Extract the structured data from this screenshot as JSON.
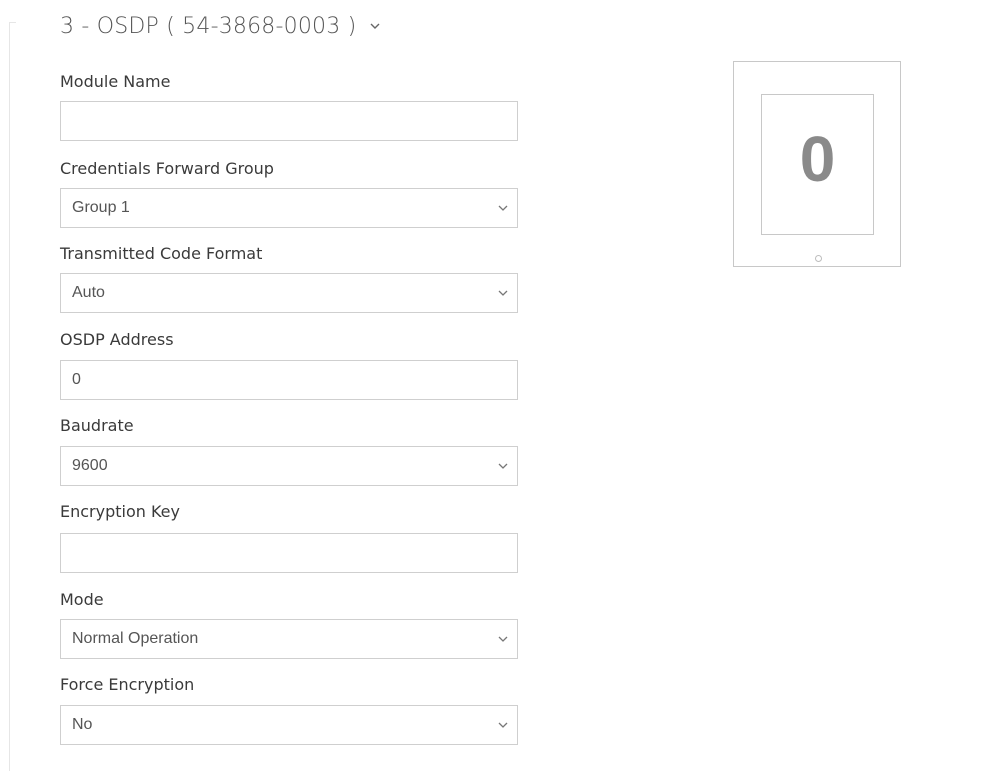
{
  "section": {
    "title": "3 - OSDP ( 54-3868-0003 )"
  },
  "fields": {
    "module_name": {
      "label": "Module Name",
      "value": ""
    },
    "credentials_forward_group": {
      "label": "Credentials Forward Group",
      "value": "Group 1"
    },
    "transmitted_code_format": {
      "label": "Transmitted Code Format",
      "value": "Auto"
    },
    "osdp_address": {
      "label": "OSDP Address",
      "value": "0"
    },
    "baudrate": {
      "label": "Baudrate",
      "value": "9600"
    },
    "encryption_key": {
      "label": "Encryption Key",
      "value": ""
    },
    "mode": {
      "label": "Mode",
      "value": "Normal Operation"
    },
    "force_encryption": {
      "label": "Force Encryption",
      "value": "No"
    }
  },
  "module_preview": {
    "display_digit": "0"
  },
  "icons": {
    "section_toggle": "chevron-down-icon",
    "select_caret": "chevron-down-icon",
    "reader_led": "led-indicator-icon"
  },
  "colors": {
    "border": "#cfcfcf",
    "label_text": "#3a3a3a",
    "value_text": "#555555",
    "digit": "#8a8a8a"
  }
}
